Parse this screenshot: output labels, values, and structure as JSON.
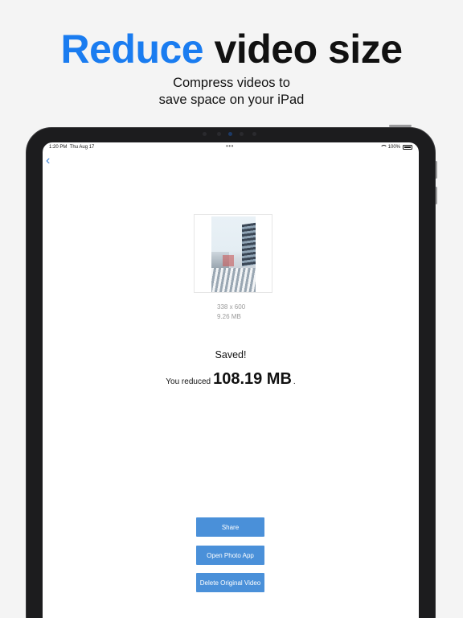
{
  "headline": {
    "accent": "Reduce",
    "rest": "video size"
  },
  "subhead": {
    "line1": "Compress videos to",
    "line2": "save space on your iPad"
  },
  "status_bar": {
    "time": "1:20 PM",
    "date": "Thu Aug 17",
    "dots": "•••",
    "battery": "100%",
    "icons": [
      "wifi-icon",
      "battery-icon"
    ]
  },
  "nav": {
    "back_icon": "chevron-left-icon",
    "back_glyph": "‹"
  },
  "video": {
    "resolution": "338 x 600",
    "size": "9.26 MB"
  },
  "result": {
    "title": "Saved!",
    "prefix": "You reduced",
    "amount": "108.19 MB",
    "suffix": "."
  },
  "actions": {
    "share": "Share",
    "open_photo": "Open Photo App",
    "delete": "Delete Original Video"
  },
  "colors": {
    "accent": "#1a7cf0",
    "button": "#4a90d9",
    "back": "#3b82d6"
  }
}
